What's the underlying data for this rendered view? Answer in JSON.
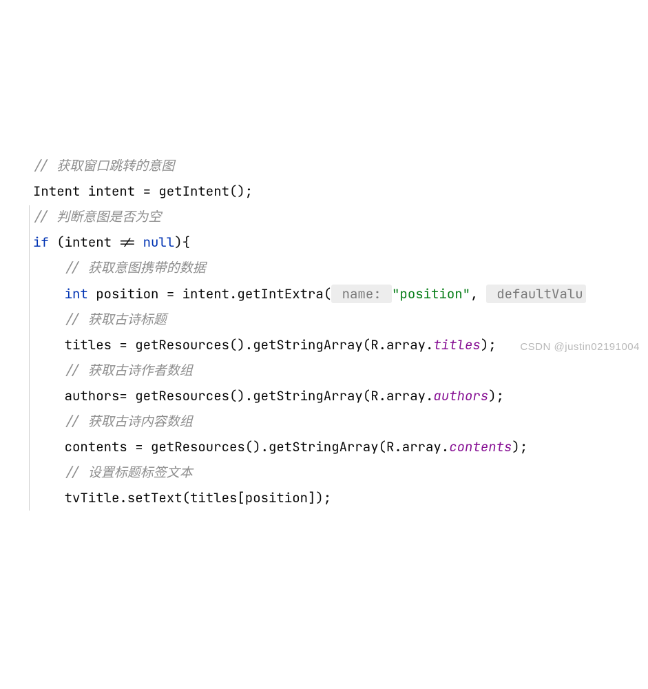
{
  "code": {
    "c1": "// 获取窗口跳转的意图",
    "l2_a": "Intent intent = getIntent();",
    "c3": "// 判断意图是否为空",
    "l4_kw_if": "if",
    "l4_a": " (intent != ",
    "l4_kw_null": "null",
    "l4_b": "){",
    "c5": "// 获取意图携带的数据",
    "l6_type": "int",
    "l6_a": " position = intent.getIntExtra(",
    "l6_hint1": " name: ",
    "l6_str": "\"position\"",
    "l6_b": ", ",
    "l6_hint2": " defaultValu",
    "c7": "// 获取古诗标题",
    "l8_a": "titles = getResources().getStringArray(R.array.",
    "l8_field": "titles",
    "l8_b": ");",
    "c9": "// 获取古诗作者数组",
    "l10_a": "authors= getResources().getStringArray(R.array.",
    "l10_field": "authors",
    "l10_b": ");",
    "c11": "// 获取古诗内容数组",
    "l12_a": "contents = getResources().getStringArray(R.array.",
    "l12_field": "contents",
    "l12_b": ");",
    "c13": "// 设置标题标签文本",
    "l14_a": "tvTitle.setText(titles[position]);"
  },
  "watermark": "CSDN @justin02191004"
}
